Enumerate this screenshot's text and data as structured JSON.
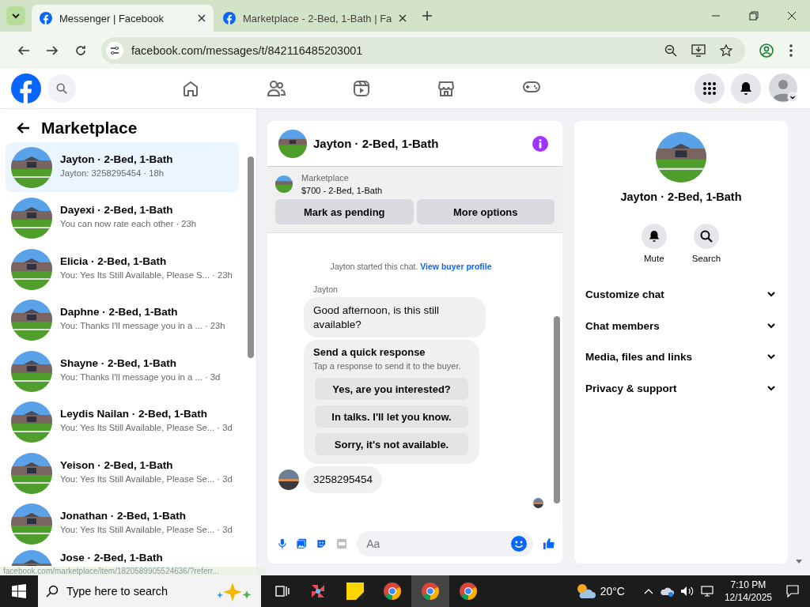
{
  "browser": {
    "tabs": [
      {
        "title": "Messenger | Facebook",
        "selected": true
      },
      {
        "title": "Marketplace - 2-Bed, 1-Bath | Fa",
        "selected": false
      }
    ],
    "url": "facebook.com/messages/t/842116485203001"
  },
  "sidebar": {
    "title": "Marketplace",
    "conversations": [
      {
        "name": "Jayton · 2-Bed, 1-Bath",
        "preview": "Jayton: 3258295454",
        "time": "· 18h",
        "selected": true
      },
      {
        "name": "Dayexi · 2-Bed, 1-Bath",
        "preview": "You can now rate each other",
        "time": "· 23h",
        "selected": false
      },
      {
        "name": "Elicia · 2-Bed, 1-Bath",
        "preview": "You: Yes Its Still Available, Please S...",
        "time": "· 23h",
        "selected": false
      },
      {
        "name": "Daphne · 2-Bed, 1-Bath",
        "preview": "You: Thanks I'll message you in a ...",
        "time": "· 23h",
        "selected": false
      },
      {
        "name": "Shayne · 2-Bed, 1-Bath",
        "preview": "You: Thanks I'll message you in a ...",
        "time": "· 3d",
        "selected": false
      },
      {
        "name": "Leydis Nailan · 2-Bed, 1-Bath",
        "preview": "You: Yes Its Still Available, Please Se...",
        "time": "· 3d",
        "selected": false
      },
      {
        "name": "Yeison · 2-Bed, 1-Bath",
        "preview": "You: Yes Its Still Available, Please Se...",
        "time": "· 3d",
        "selected": false
      },
      {
        "name": "Jonathan · 2-Bed, 1-Bath",
        "preview": "You: Yes Its Still Available, Please Se...",
        "time": "· 3d",
        "selected": false
      },
      {
        "name": "Jose · 2-Bed, 1-Bath",
        "selected": false
      }
    ]
  },
  "chat": {
    "title": "Jayton · 2-Bed, 1-Bath",
    "listing": {
      "label": "Marketplace",
      "summary": "$700 - 2-Bed, 1-Bath"
    },
    "actions": [
      "Mark as pending",
      "More options"
    ],
    "system_note": "Jayton started this chat.",
    "system_link": "View buyer profile",
    "sender": "Jayton",
    "message": "Good afternoon, is this still available?",
    "quick_response": {
      "title": "Send a quick response",
      "hint": "Tap a response to send it to the buyer.",
      "options": [
        "Yes, are you interested?",
        "In talks. I'll let you know.",
        "Sorry, it's not available."
      ]
    },
    "reply": "3258295454",
    "composer": {
      "placeholder": "Aa"
    }
  },
  "info": {
    "title": "Jayton · 2-Bed, 1-Bath",
    "actions": [
      {
        "kind": "mute",
        "label": "Mute"
      },
      {
        "kind": "search",
        "label": "Search"
      }
    ],
    "sections": [
      "Customize chat",
      "Chat members",
      "Media, files and links",
      "Privacy & support"
    ]
  },
  "status_url": "facebook.com/marketplace/item/1820589905524636/?referr...",
  "taskbar": {
    "search_placeholder": "Type here to search",
    "temperature": "20°C",
    "time": "7:10 PM",
    "date": "12/14/2025"
  }
}
